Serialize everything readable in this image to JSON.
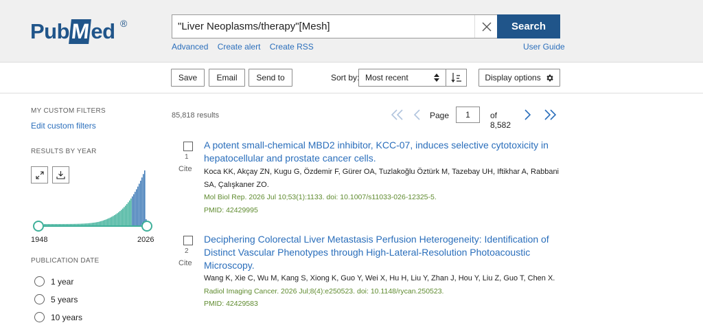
{
  "header": {
    "logo_text_1": "Pub",
    "logo_text_m": "M",
    "logo_text_2": "ed",
    "logo_reg": "®",
    "search_value": "\"Liver Neoplasms/therapy\"[Mesh]",
    "search_button": "Search",
    "links": [
      "Advanced",
      "Create alert",
      "Create RSS"
    ],
    "user_guide": "User Guide",
    "brand_color": "#20558a",
    "link_color": "#2a6ebb"
  },
  "toolbar": {
    "save": "Save",
    "email": "Email",
    "send_to": "Send to",
    "sort_by_label": "Sort by:",
    "sort_value": "Most recent",
    "display_options": "Display options",
    "icons": [
      "sort-updown-icon",
      "sort-direction-icon",
      "gear-icon"
    ]
  },
  "sidebar": {
    "custom_filters_heading": "MY CUSTOM FILTERS",
    "edit_custom_filters": "Edit custom filters",
    "results_by_year_heading": "RESULTS BY YEAR",
    "year_start": "1948",
    "year_end": "2026",
    "histogram_colors": [
      "#3fb09a",
      "#3c78b6"
    ],
    "publication_date_heading": "PUBLICATION DATE",
    "date_options": [
      "1 year",
      "5 years",
      "10 years"
    ]
  },
  "results": {
    "count": "85,818 results",
    "page_label": "Page",
    "page_value": "1",
    "page_of": "of 8,582",
    "items": [
      {
        "num": "1",
        "cite": "Cite",
        "title": "A potent small-chemical MBD2 inhibitor, KCC-07, induces selective cytotoxicity in hepatocellular and prostate cancer cells.",
        "authors": "Koca KK, Akçay ZN, Kugu G, Özdemir F, Gürer OA, Tuzlakoğlu Öztürk M, Tazebay UH, Iftikhar A, Rabbani SA, Çalışkaner ZO.",
        "journal": "Mol Biol Rep. 2026 Jul 10;53(1):1133. doi: 10.1007/s11033-026-12325-5.",
        "pmid": "PMID: 42429995"
      },
      {
        "num": "2",
        "cite": "Cite",
        "title": "Deciphering Colorectal Liver Metastasis Perfusion Heterogeneity: Identification of Distinct Vascular Phenotypes through High-Lateral-Resolution Photoacoustic Microscopy.",
        "authors": "Wang K, Xie C, Wu M, Kang S, Xiong K, Guo Y, Wei X, Hu H, Liu Y, Zhan J, Hou Y, Liu Z, Guo T, Chen X.",
        "journal": "Radiol Imaging Cancer. 2026 Jul;8(4):e250523. doi: 10.1148/rycan.250523.",
        "pmid": "PMID: 42429583"
      }
    ]
  }
}
